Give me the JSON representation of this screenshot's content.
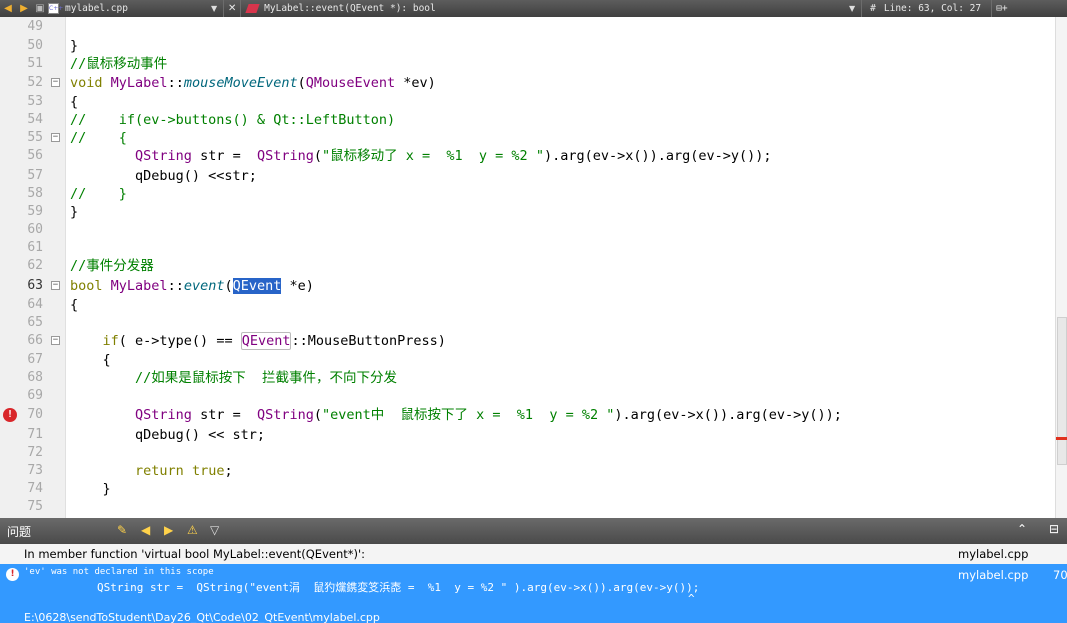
{
  "toolbar": {
    "file_name": "mylabel.cpp",
    "close_symbol": "✕",
    "function_sig": "MyLabel::event(QEvent *): bool",
    "hash": "#",
    "position": "Line: 63, Col: 27",
    "split_symbol": "⊟+"
  },
  "editor": {
    "lines": [
      {
        "n": "49",
        "text": ""
      },
      {
        "n": "50",
        "text": "}"
      },
      {
        "n": "51",
        "text": "//鼠标移动事件"
      },
      {
        "n": "52",
        "text": "void MyLabel::mouseMoveEvent(QMouseEvent *ev)"
      },
      {
        "n": "53",
        "text": "{"
      },
      {
        "n": "54",
        "text": "//    if(ev->buttons() & Qt::LeftButton)"
      },
      {
        "n": "55",
        "text": "//    {"
      },
      {
        "n": "56",
        "text": "        QString str =  QString(\"鼠标移动了 x =  %1  y = %2 \").arg(ev->x()).arg(ev->y());"
      },
      {
        "n": "57",
        "text": "        qDebug() <<str;"
      },
      {
        "n": "58",
        "text": "//    }"
      },
      {
        "n": "59",
        "text": "}"
      },
      {
        "n": "60",
        "text": ""
      },
      {
        "n": "61",
        "text": ""
      },
      {
        "n": "62",
        "text": "//事件分发器"
      },
      {
        "n": "63",
        "text": "bool MyLabel::event(QEvent *e)"
      },
      {
        "n": "64",
        "text": "{"
      },
      {
        "n": "65",
        "text": ""
      },
      {
        "n": "66",
        "text": "    if( e->type() == QEvent::MouseButtonPress)"
      },
      {
        "n": "67",
        "text": "    {"
      },
      {
        "n": "68",
        "text": "        //如果是鼠标按下  拦截事件，不向下分发"
      },
      {
        "n": "69",
        "text": ""
      },
      {
        "n": "70",
        "text": "        QString str =  QString(\"event中  鼠标按下了 x =  %1  y = %2 \").arg(ev->x()).arg(ev->y());"
      },
      {
        "n": "71",
        "text": "        qDebug() << str;"
      },
      {
        "n": "72",
        "text": ""
      },
      {
        "n": "73",
        "text": "        return true;"
      },
      {
        "n": "74",
        "text": "    }"
      },
      {
        "n": "75",
        "text": ""
      }
    ]
  },
  "issues_panel": {
    "title": "问题",
    "header_message": "In member function 'virtual bool MyLabel::event(QEvent*)':",
    "header_file": "mylabel.cpp",
    "error_message": "'ev' was not declared in this scope",
    "error_code_line": "QString str =  QString(\"event涓  鼠犳爣鎸変笅浜唜 =  %1  y = %2 \" ).arg(ev->x()).arg(ev->y());",
    "error_caret": "^",
    "error_path": "E:\\0628\\sendToStudent\\Day26_Qt\\Code\\02_QtEvent\\mylabel.cpp",
    "error_file": "mylabel.cpp",
    "error_line": "70"
  },
  "colors": {
    "selection": "#2864c8",
    "issue_selected": "#3399ff",
    "error": "#d9262a"
  }
}
